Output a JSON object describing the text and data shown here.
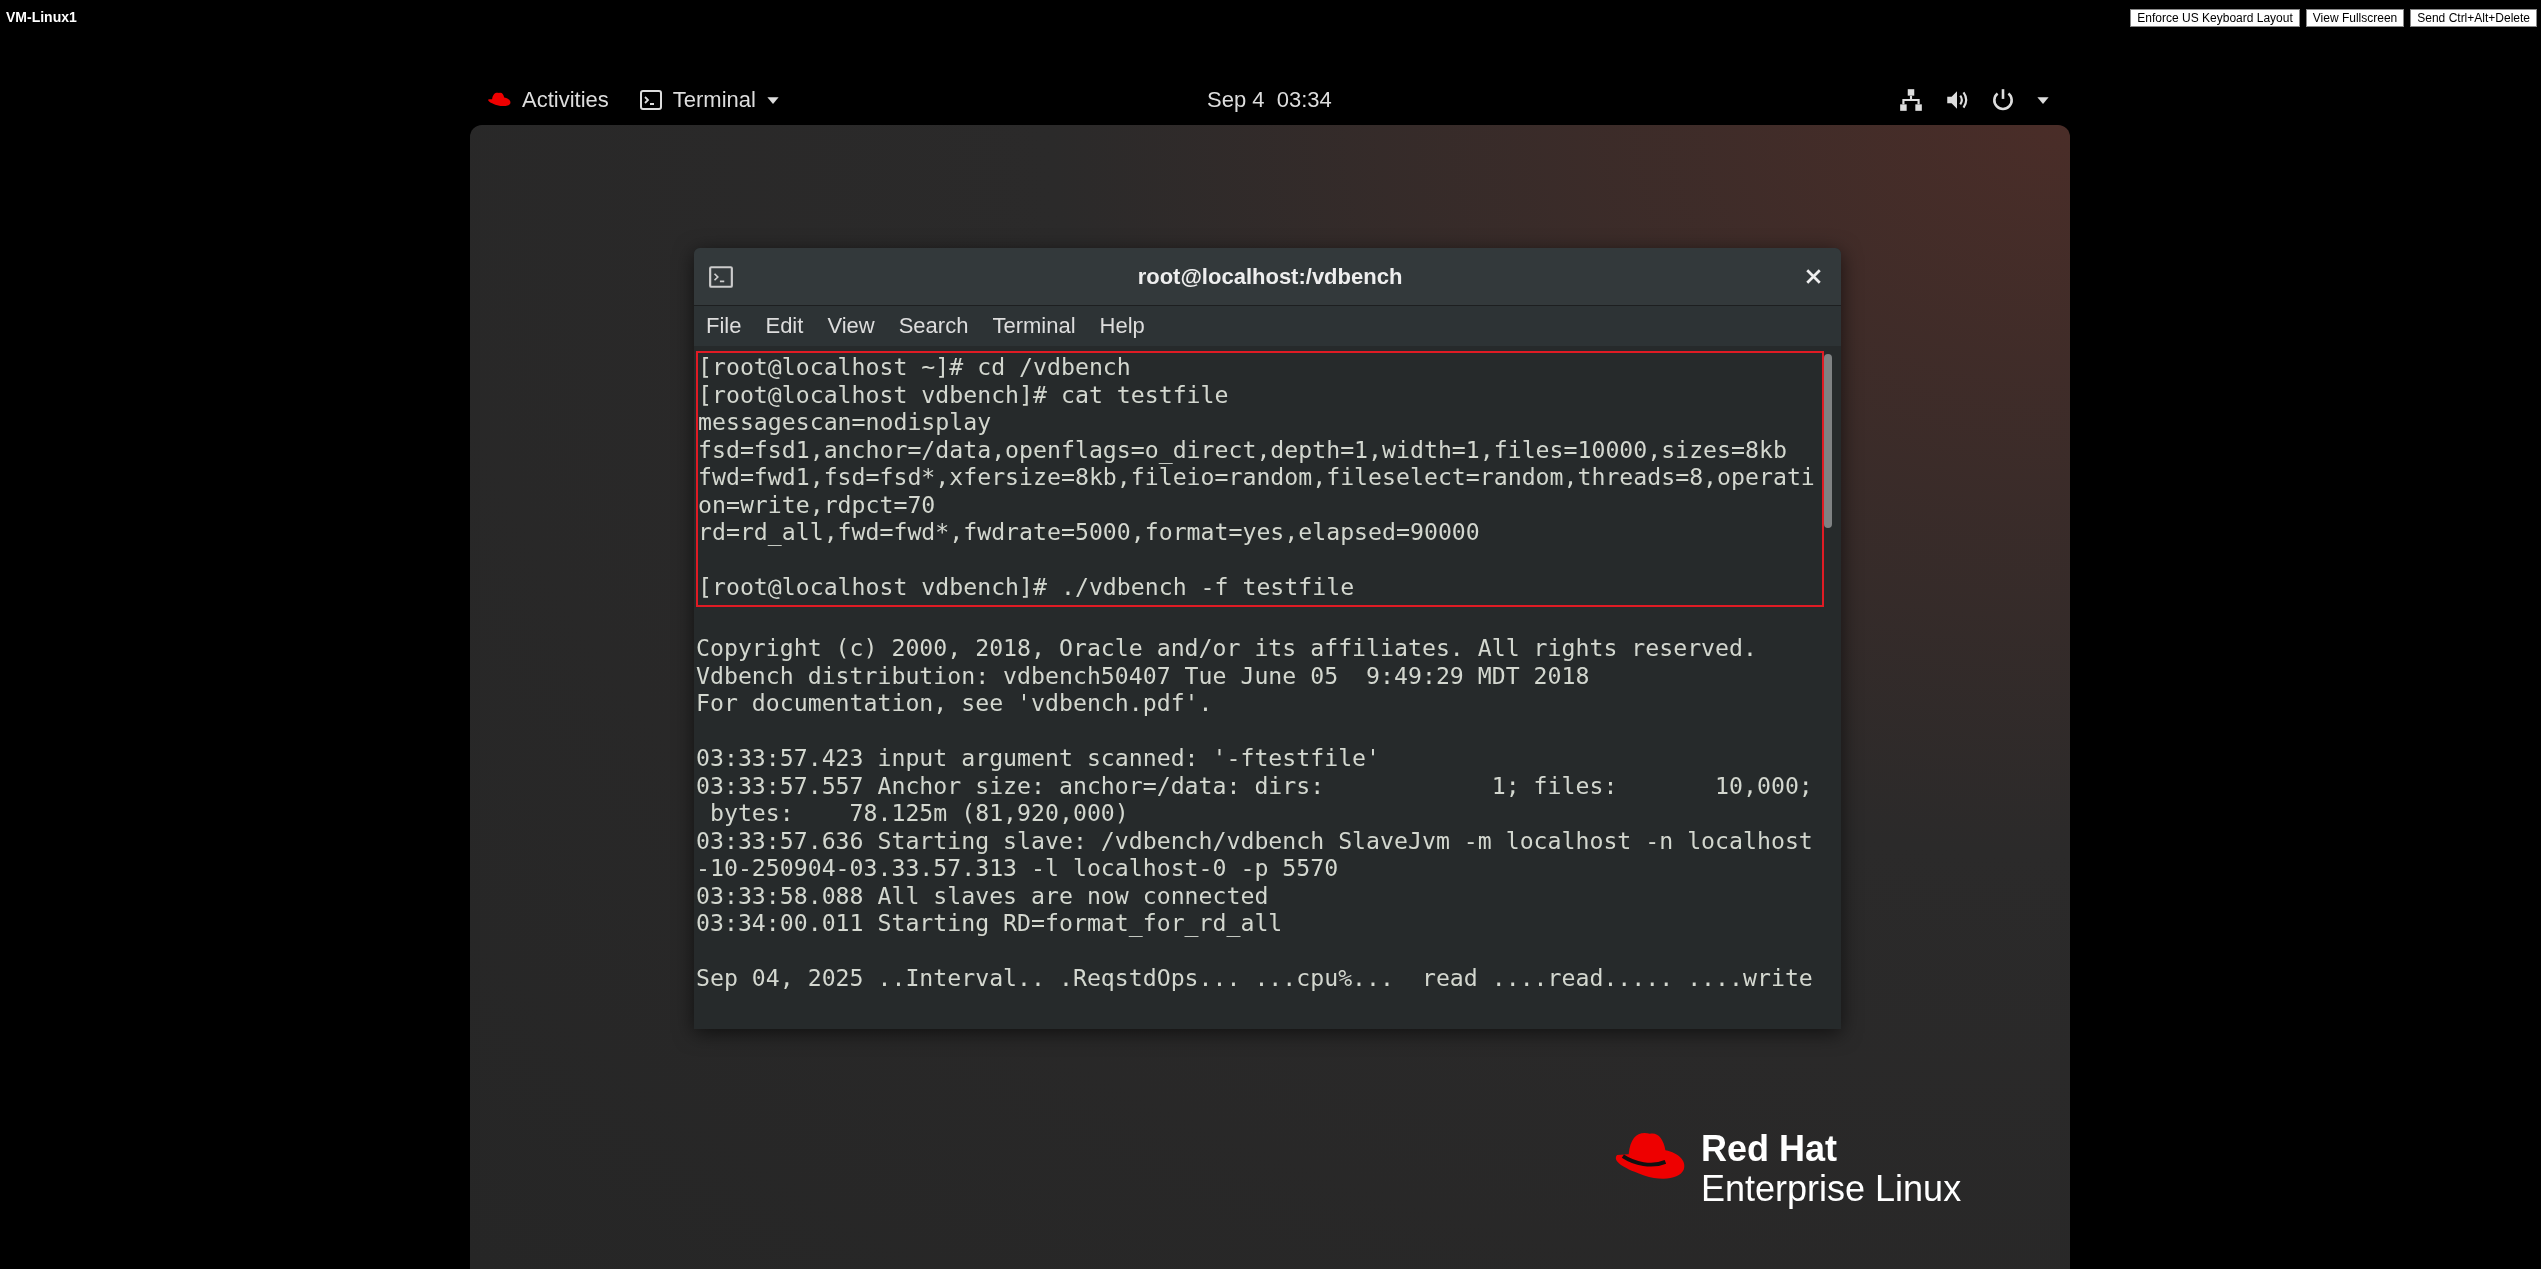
{
  "vm_toolbar": {
    "title": "VM-Linux1",
    "buttons": [
      "Enforce US Keyboard Layout",
      "View Fullscreen",
      "Send Ctrl+Alt+Delete"
    ]
  },
  "top_bar": {
    "activities": "Activities",
    "app_menu": "Terminal",
    "clock": "Sep 4  03:34"
  },
  "terminal": {
    "title": "root@localhost:/vdbench",
    "menu": [
      "File",
      "Edit",
      "View",
      "Search",
      "Terminal",
      "Help"
    ],
    "highlighted_paragraphs": [
      [
        "[root@localhost ~]# cd /vdbench",
        "[root@localhost vdbench]# cat testfile",
        "messagescan=nodisplay",
        "fsd=fsd1,anchor=/data,openflags=o_direct,depth=1,width=1,files=10000,sizes=8kb",
        "fwd=fwd1,fsd=fsd*,xfersize=8kb,fileio=random,fileselect=random,threads=8,operati",
        "on=write,rdpct=70",
        "rd=rd_all,fwd=fwd*,fwdrate=5000,format=yes,elapsed=90000"
      ],
      [
        "[root@localhost vdbench]# ./vdbench -f testfile"
      ]
    ],
    "output_paragraphs": [
      [
        "Copyright (c) 2000, 2018, Oracle and/or its affiliates. All rights reserved.",
        "Vdbench distribution: vdbench50407 Tue June 05  9:49:29 MDT 2018",
        "For documentation, see 'vdbench.pdf'."
      ],
      [
        "03:33:57.423 input argument scanned: '-ftestfile'",
        "03:33:57.557 Anchor size: anchor=/data: dirs:            1; files:       10,000;",
        " bytes:    78.125m (81,920,000)",
        "03:33:57.636 Starting slave: /vdbench/vdbench SlaveJvm -m localhost -n localhost",
        "-10-250904-03.33.57.313 -l localhost-0 -p 5570",
        "03:33:58.088 All slaves are now connected",
        "03:34:00.011 Starting RD=format_for_rd_all"
      ],
      [
        "Sep 04, 2025 ..Interval.. .ReqstdOps... ...cpu%...  read ....read..... ....write"
      ]
    ]
  },
  "logo": {
    "brand": "Red Hat",
    "product": "Enterprise Linux"
  }
}
